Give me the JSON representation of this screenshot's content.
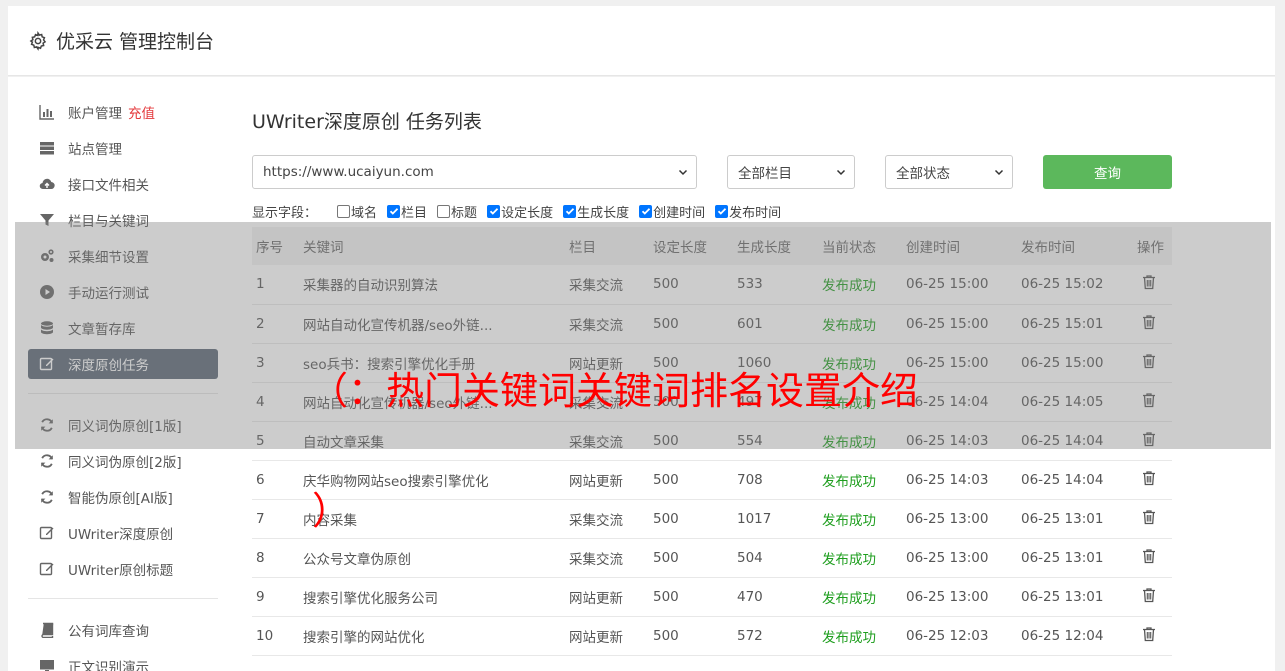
{
  "header": {
    "title": "优采云 管理控制台"
  },
  "sidebar": {
    "items": [
      {
        "label": "账户管理",
        "extra": "充值",
        "icon": "bar-chart-icon"
      },
      {
        "label": "站点管理",
        "icon": "server-icon"
      },
      {
        "label": "接口文件相关",
        "icon": "cloud-upload-icon"
      },
      {
        "label": "栏目与关键词",
        "icon": "filter-icon"
      },
      {
        "label": "采集细节设置",
        "icon": "cogs-icon"
      },
      {
        "label": "手动运行测试",
        "icon": "play-circle-icon"
      },
      {
        "label": "文章暂存库",
        "icon": "database-icon"
      },
      {
        "label": "深度原创任务",
        "icon": "edit-icon"
      }
    ],
    "items2": [
      {
        "label": "同义词伪原创[1版]",
        "icon": "refresh-icon"
      },
      {
        "label": "同义词伪原创[2版]",
        "icon": "refresh-icon"
      },
      {
        "label": "智能伪原创[AI版]",
        "icon": "refresh-icon"
      },
      {
        "label": "UWriter深度原创",
        "icon": "edit-icon"
      },
      {
        "label": "UWriter原创标题",
        "icon": "edit-icon"
      }
    ],
    "items3": [
      {
        "label": "公有词库查询",
        "icon": "book-icon"
      },
      {
        "label": "正文识别演示",
        "icon": "monitor-icon"
      }
    ]
  },
  "main": {
    "title": "UWriter深度原创 任务列表",
    "site_select": "https://www.ucaiyun.com",
    "column_select": "全部栏目",
    "status_select": "全部状态",
    "query_label": "查询",
    "fields_label": "显示字段：",
    "fields": [
      {
        "label": "域名",
        "checked": false
      },
      {
        "label": "栏目",
        "checked": true
      },
      {
        "label": "标题",
        "checked": false
      },
      {
        "label": "设定长度",
        "checked": true
      },
      {
        "label": "生成长度",
        "checked": true
      },
      {
        "label": "创建时间",
        "checked": true
      },
      {
        "label": "发布时间",
        "checked": true
      }
    ],
    "columns": [
      "序号",
      "关键词",
      "栏目",
      "设定长度",
      "生成长度",
      "当前状态",
      "创建时间",
      "发布时间",
      "操作"
    ],
    "rows": [
      [
        "1",
        "采集器的自动识别算法",
        "采集交流",
        "500",
        "533",
        "发布成功",
        "06-25 15:00",
        "06-25 15:02"
      ],
      [
        "2",
        "网站自动化宣传机器/seo外链...",
        "采集交流",
        "500",
        "601",
        "发布成功",
        "06-25 15:00",
        "06-25 15:01"
      ],
      [
        "3",
        "seo兵书：搜索引擎优化手册",
        "网站更新",
        "500",
        "1060",
        "发布成功",
        "06-25 15:00",
        "06-25 15:00"
      ],
      [
        "4",
        "网站自动化宣传机器/seo外链...",
        "采集交流",
        "500",
        "497",
        "发布成功",
        "06-25 14:04",
        "06-25 14:05"
      ],
      [
        "5",
        "自动文章采集",
        "采集交流",
        "500",
        "554",
        "发布成功",
        "06-25 14:03",
        "06-25 14:04"
      ],
      [
        "6",
        "庆华购物网站seo搜索引擎优化",
        "网站更新",
        "500",
        "708",
        "发布成功",
        "06-25 14:03",
        "06-25 14:04"
      ],
      [
        "7",
        "内容采集",
        "采集交流",
        "500",
        "1017",
        "发布成功",
        "06-25 13:00",
        "06-25 13:01"
      ],
      [
        "8",
        "公众号文章伪原创",
        "采集交流",
        "500",
        "504",
        "发布成功",
        "06-25 13:00",
        "06-25 13:01"
      ],
      [
        "9",
        "搜索引擎优化服务公司",
        "网站更新",
        "500",
        "470",
        "发布成功",
        "06-25 13:00",
        "06-25 13:01"
      ],
      [
        "10",
        "搜索引擎的网站优化",
        "网站更新",
        "500",
        "572",
        "发布成功",
        "06-25 12:03",
        "06-25 12:04"
      ]
    ]
  },
  "overlay": {
    "text": "（：热门关键词关键词排名设置介绍",
    "text2": "）"
  },
  "colors": {
    "active_nav": "#5a6775",
    "query_button": "#5cb85c",
    "success": "#1e9e1e",
    "accent_red": "#e4393c",
    "overlay_text": "#ff0000"
  }
}
